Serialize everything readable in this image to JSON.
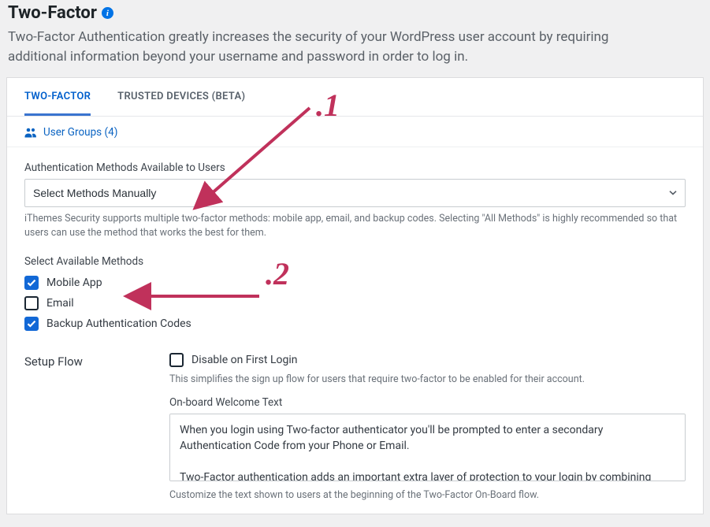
{
  "header": {
    "title": "Two-Factor",
    "description": "Two-Factor Authentication greatly increases the security of your WordPress user account by requiring additional information beyond your username and password in order to log in."
  },
  "tabs": {
    "two_factor": "TWO-FACTOR",
    "trusted_devices": "TRUSTED DEVICES (BETA)"
  },
  "user_groups": {
    "label": "User Groups (4)"
  },
  "auth_methods": {
    "label": "Authentication Methods Available to Users",
    "selected": "Select Methods Manually",
    "helper": "iThemes Security supports multiple two-factor methods: mobile app, email, and backup codes. Selecting \"All Methods\" is highly recommended so that users can use the method that works the best for them."
  },
  "available_methods": {
    "label": "Select Available Methods",
    "items": [
      {
        "label": "Mobile App",
        "checked": true
      },
      {
        "label": "Email",
        "checked": false
      },
      {
        "label": "Backup Authentication Codes",
        "checked": true
      }
    ]
  },
  "setup_flow": {
    "heading": "Setup Flow",
    "disable_label": "Disable on First Login",
    "disable_checked": false,
    "disable_helper": "This simplifies the sign up flow for users that require two-factor to be enabled for their account.",
    "onboard_label": "On-board Welcome Text",
    "onboard_text": "When you login using Two-factor authenticator you'll be prompted to enter a secondary Authentication Code from your Phone or Email.\n\nTwo-Factor authentication adds an important extra layer of protection to your login by combining something",
    "onboard_helper": "Customize the text shown to users at the beginning of the Two-Factor On-Board flow."
  },
  "annotations": {
    "one": ".1",
    "two": ".2",
    "color": "#c0315b"
  }
}
